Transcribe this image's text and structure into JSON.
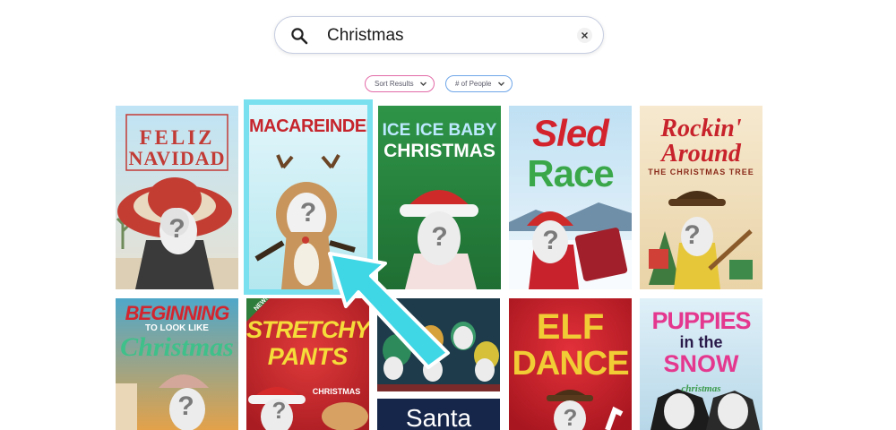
{
  "search": {
    "value": "Christmas",
    "icon": "search-icon",
    "clear_icon": "close-icon"
  },
  "filters": {
    "sort_label": "Sort Results",
    "people_label": "# of People"
  },
  "colors": {
    "selected_highlight": "#78e0ee",
    "sort_border": "#e36aa7",
    "people_border": "#6ea6e8",
    "arrow": "#3fd6e6"
  },
  "cards": [
    {
      "title_line1": "FELIZ",
      "title_line2": "NAVIDAD"
    },
    {
      "title_line1": "MACAREINDEER",
      "selected": true
    },
    {
      "title_line1": "ICE ICE BABY",
      "title_line2": "CHRISTMAS"
    },
    {
      "title_line1": "Sled",
      "title_line2": "Race"
    },
    {
      "title_line1": "Rockin'",
      "title_line2": "Around",
      "title_line3": "THE CHRISTMAS TREE"
    },
    {
      "title_line1": "BEGINNING",
      "title_line2": "TO LOOK LIKE",
      "title_line3": "Christmas"
    },
    {
      "badge": "NEW!",
      "title_line1": "STRETCHY",
      "title_line2": "PANTS",
      "title_line3": "CHRISTMAS"
    },
    {
      "title_line1": ""
    },
    {
      "title_line1": "Santa"
    },
    {
      "title_line1": "ELF",
      "title_line2": "DANCE"
    },
    {
      "title_line1": "PUPPIES",
      "title_line2": "in the",
      "title_line3": "SNOW",
      "title_line4": "christmas"
    }
  ]
}
